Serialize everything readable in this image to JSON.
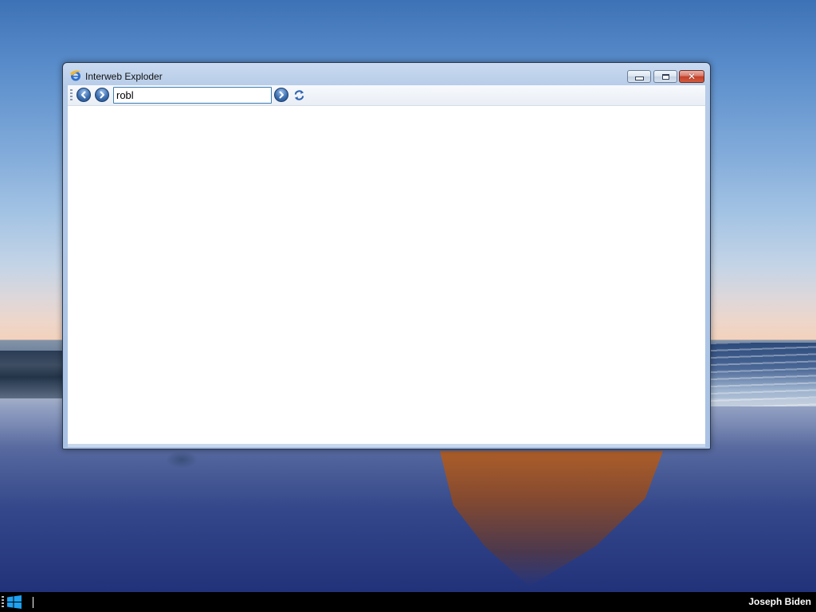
{
  "window": {
    "title": "Interweb Exploder",
    "app_icon": "ie-logo-icon",
    "controls": {
      "minimize_icon": "minimize-icon",
      "maximize_icon": "maximize-icon",
      "close_label": "✕"
    }
  },
  "toolbar": {
    "back_icon": "back-arrow-icon",
    "forward_icon": "forward-arrow-icon",
    "address_value": "robl",
    "go_icon": "go-arrow-icon",
    "refresh_icon": "refresh-icon"
  },
  "taskbar": {
    "start_icon": "windows-logo-icon",
    "user_name": "Joseph Biden"
  },
  "colors": {
    "taskbar_bg": "#000000",
    "window_frame": "#a9c2e4",
    "close_button": "#c2402b",
    "nav_button": "#3d6fb0"
  }
}
